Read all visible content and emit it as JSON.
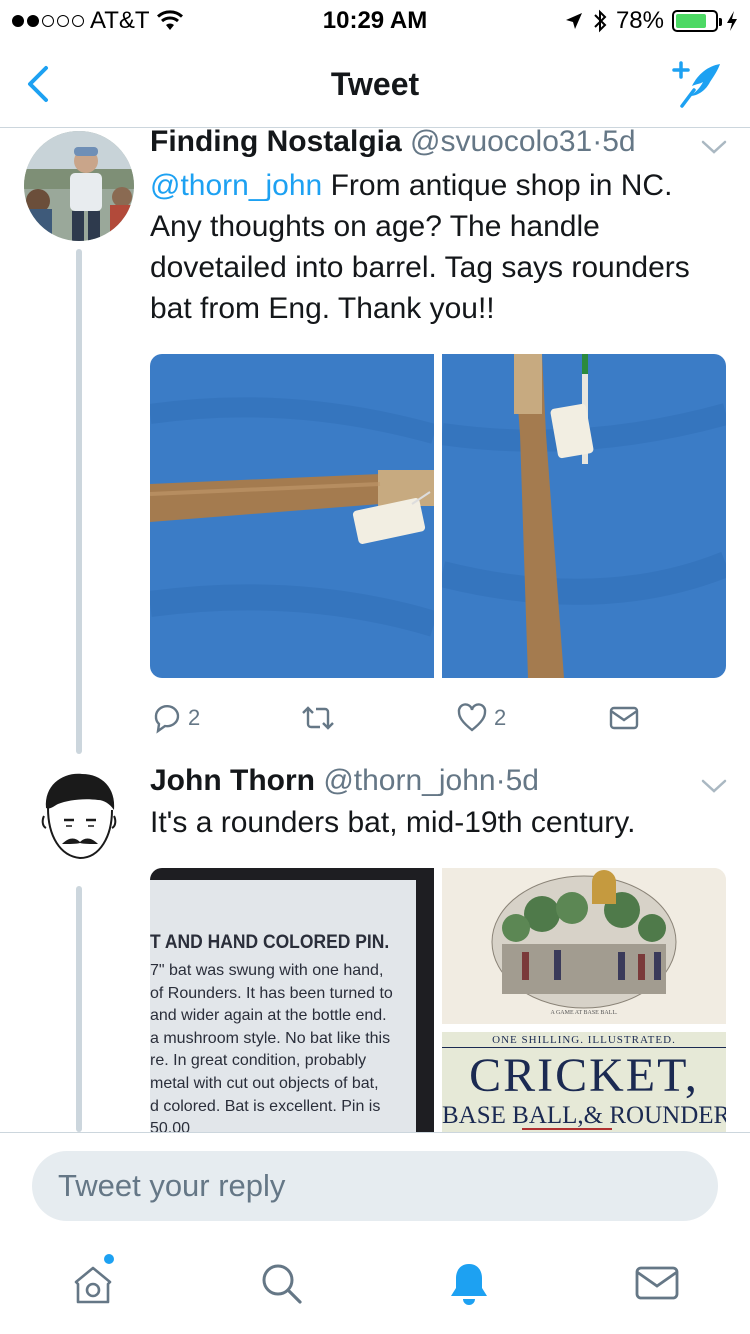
{
  "status_bar": {
    "carrier": "AT&T",
    "time": "10:29 AM",
    "battery": "78%",
    "battery_level": 0.78,
    "signal_bars_filled": 2,
    "signal_bars_total": 5
  },
  "nav": {
    "title": "Tweet",
    "back_icon": "chevron-left-icon",
    "compose_icon": "compose-tweet-icon"
  },
  "tweets": [
    {
      "name": "Finding Nostalgia",
      "handle": "@svuocolo31",
      "separator": "·",
      "time": "5d",
      "mention": "@thorn_john",
      "text": " From antique shop in NC. Any thoughts on age? The handle dovetailed into barrel. Tag says rounders bat from Eng. Thank you!!",
      "reply_count": "2",
      "like_count": "2"
    },
    {
      "name": "John Thorn",
      "handle": "@thorn_john",
      "separator": "·",
      "time": "5d",
      "text": "It's a rounders bat, mid-19th century.",
      "media": {
        "card_heading": "T AND HAND COLORED PIN.",
        "card_lines": [
          "7\" bat was swung with one hand,",
          "of Rounders. It has been turned to",
          "and wider again at the bottle end.",
          "a mushroom style. No bat like this",
          "re. In great condition, probably",
          "metal with cut out objects of bat,",
          "d colored. Bat is excellent. Pin is",
          "50.00"
        ],
        "engraving_caption": "A GAME AT BASE BALL.",
        "book_top": "ONE  SHILLING.   ILLUSTRATED.",
        "book_title": "CRICKET,",
        "book_subtitle": "BASE BALL,& ROUNDERS"
      }
    }
  ],
  "reply": {
    "placeholder": "Tweet your reply"
  },
  "tabs": [
    "home-icon",
    "search-icon",
    "notifications-icon",
    "messages-icon"
  ],
  "colors": {
    "accent": "#1da1f2",
    "text": "#14171a",
    "muted": "#657786",
    "divider": "#ccd6dd",
    "input_bg": "#e6ecf0"
  }
}
